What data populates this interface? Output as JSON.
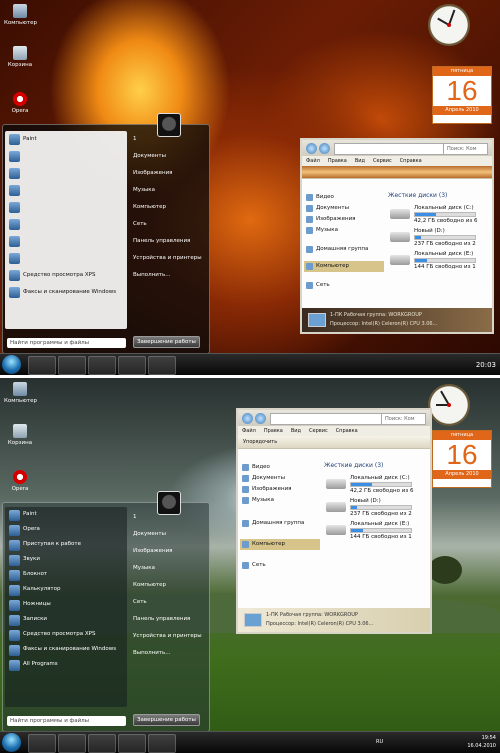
{
  "top": {
    "desktop_icons": [
      {
        "label": "Компьютер",
        "icon": "computer-icon"
      },
      {
        "label": "Корзина",
        "icon": "recycle-bin-icon"
      },
      {
        "label": "Opera",
        "icon": "opera-icon"
      }
    ],
    "calendar": {
      "weekday": "пятница",
      "day": "16",
      "month_year": "Апрель 2010"
    },
    "start_menu": {
      "pinned": [
        "Paint",
        "",
        "",
        "",
        "",
        "",
        "",
        "",
        "Средство просмотра XPS",
        "Факсы и сканирование Windows"
      ],
      "right": [
        "1",
        "Документы",
        "Изображения",
        "Музыка",
        "Компьютер",
        "Сеть",
        "Панель управления",
        "Устройства и принтеры",
        "Выполнить..."
      ],
      "search_placeholder": "Найти программы и файлы",
      "shutdown_label": "Завершение работы"
    },
    "explorer": {
      "search": "Поиск: Ком",
      "menu": [
        "Файл",
        "Правка",
        "Вид",
        "Сервис",
        "Справка"
      ],
      "nav": [
        "Видео",
        "Документы",
        "Изображения",
        "Музыка",
        "Домашняя группа",
        "Компьютер",
        "Сеть"
      ],
      "group": "Жесткие диски (3)",
      "drives": [
        {
          "name": "Локальный диск (C:)",
          "free": "42,2 ГБ свободно из 6",
          "used": 0.35
        },
        {
          "name": "Новый (D:)",
          "free": "237 ГБ свободно из 2",
          "used": 0.1
        },
        {
          "name": "Локальный диск (E:)",
          "free": "144 ГБ свободно из 1",
          "used": 0.2
        }
      ],
      "details_line1": "1-ПК  Рабочая группа: WORKGROUP",
      "details_line2": "Процессор: Intel(R) Celeron(R) CPU 3.06..."
    },
    "tray_time": "20:03"
  },
  "bottom": {
    "desktop_icons": [
      {
        "label": "Компьютер",
        "icon": "computer-icon"
      },
      {
        "label": "Корзина",
        "icon": "recycle-bin-icon"
      },
      {
        "label": "Opera",
        "icon": "opera-icon"
      }
    ],
    "calendar": {
      "weekday": "пятница",
      "day": "16",
      "month_year": "Апрель 2010"
    },
    "start_menu": {
      "pinned": [
        "Paint",
        "Opera",
        "Приступая к работе",
        "Звуки",
        "Блокнот",
        "Калькулятор",
        "Ножницы",
        "Записки",
        "Средство просмотра XPS",
        "Факсы и сканирование Windows",
        "All Programs"
      ],
      "right": [
        "1",
        "Документы",
        "Изображения",
        "Музыка",
        "Компьютер",
        "Сеть",
        "Панель управления",
        "Устройства и принтеры",
        "Выполнить..."
      ],
      "search_placeholder": "Найти программы и файлы",
      "shutdown_label": "Завершение работы"
    },
    "explorer": {
      "search": "Поиск: Ком",
      "menu": [
        "Файл",
        "Правка",
        "Вид",
        "Сервис",
        "Справка"
      ],
      "organize": "Упорядочить",
      "nav": [
        "Видео",
        "Документы",
        "Изображения",
        "Музыка",
        "Домашняя группа",
        "Компьютер",
        "Сеть"
      ],
      "group": "Жесткие диски (3)",
      "drives": [
        {
          "name": "Локальный диск (C:)",
          "free": "42,2 ГБ свободно из 6",
          "used": 0.35
        },
        {
          "name": "Новый (D:)",
          "free": "237 ГБ свободно из 2",
          "used": 0.1
        },
        {
          "name": "Локальный диск (E:)",
          "free": "144 ГБ свободно из 1",
          "used": 0.2
        }
      ],
      "details_line1": "1-ПК  Рабочая группа: WORKGROUP",
      "details_line2": "Процессор: Intel(R) Celeron(R) CPU 3.06..."
    },
    "tray_lang": "RU",
    "tray_time": "19:54",
    "tray_date": "16.04.2010"
  }
}
